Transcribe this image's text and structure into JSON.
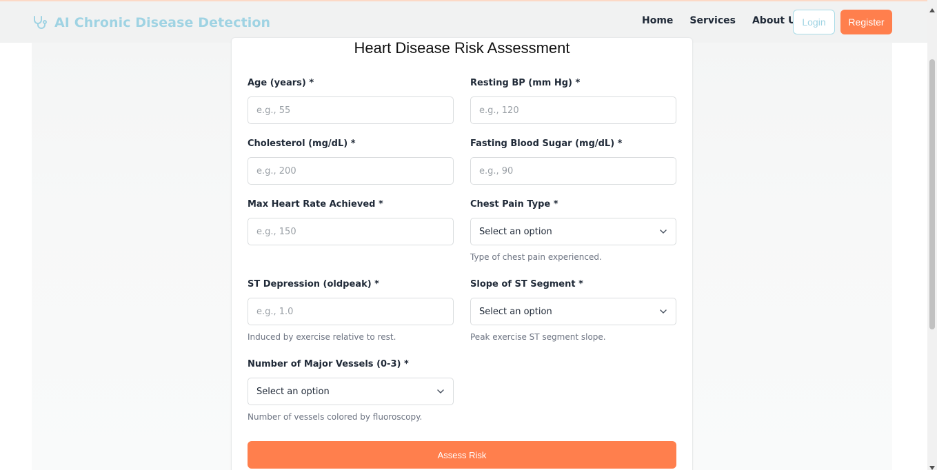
{
  "navbar": {
    "brand": "AI Chronic Disease Detection",
    "brand_icon": "stethoscope-icon",
    "links": [
      "Home",
      "Services",
      "About Us"
    ],
    "login_label": "Login",
    "register_label": "Register"
  },
  "form": {
    "title": "Heart Disease Risk Assessment",
    "fields": {
      "age": {
        "label": "Age (years) *",
        "placeholder": "e.g., 55"
      },
      "resting_bp": {
        "label": "Resting BP (mm Hg) *",
        "placeholder": "e.g., 120"
      },
      "cholesterol": {
        "label": "Cholesterol (mg/dL) *",
        "placeholder": "e.g., 200"
      },
      "fasting_sugar": {
        "label": "Fasting Blood Sugar (mg/dL) *",
        "placeholder": "e.g., 90"
      },
      "max_hr": {
        "label": "Max Heart Rate Achieved *",
        "placeholder": "e.g., 150"
      },
      "chest_pain": {
        "label": "Chest Pain Type *",
        "value": "Select an option",
        "help": "Type of chest pain experienced."
      },
      "st_depression": {
        "label": "ST Depression (oldpeak) *",
        "placeholder": "e.g., 1.0",
        "help": "Induced by exercise relative to rest."
      },
      "st_slope": {
        "label": "Slope of ST Segment *",
        "value": "Select an option",
        "help": "Peak exercise ST segment slope."
      },
      "vessels": {
        "label": "Number of Major Vessels (0-3) *",
        "value": "Select an option",
        "help": "Number of vessels colored by fluoroscopy."
      }
    },
    "submit_label": "Assess Risk"
  },
  "colors": {
    "accent": "#ff7f4d",
    "brand": "#9fd3e3"
  }
}
